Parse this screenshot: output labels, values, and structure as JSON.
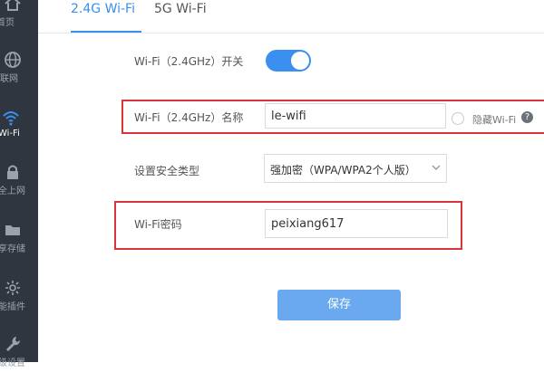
{
  "sidebar": {
    "items": [
      {
        "label": "首页",
        "icon": "home-icon"
      },
      {
        "label": "互联网",
        "icon": "globe-icon"
      },
      {
        "label": "Wi-Fi",
        "icon": "wifi-icon",
        "active": true
      },
      {
        "label": "安全上网",
        "icon": "lock-icon"
      },
      {
        "label": "共享存储",
        "icon": "folder-icon"
      },
      {
        "label": "智能插件",
        "icon": "plugin-icon"
      },
      {
        "label": "高级设置",
        "icon": "wrench-icon"
      }
    ]
  },
  "tabs": [
    {
      "label": "2.4G Wi-Fi",
      "active": true
    },
    {
      "label": "5G Wi-Fi",
      "active": false
    }
  ],
  "form": {
    "switch_label": "Wi-Fi（2.4GHz）开关",
    "switch_on": true,
    "name_label": "Wi-Fi（2.4GHz）名称",
    "name_value": "le-wifi",
    "hide_label": "隐藏Wi-Fi",
    "security_label": "设置安全类型",
    "security_value": "强加密（WPA/WPA2个人版）",
    "password_label": "Wi-Fi密码",
    "password_value": "peixiang617",
    "help_icon": "question-circle-icon"
  },
  "save_label": "保存",
  "colors": {
    "accent": "#3b8ff0",
    "sidebar_bg": "#2f3640",
    "highlight": "#d9343a",
    "save_button": "#6aa8ef"
  }
}
